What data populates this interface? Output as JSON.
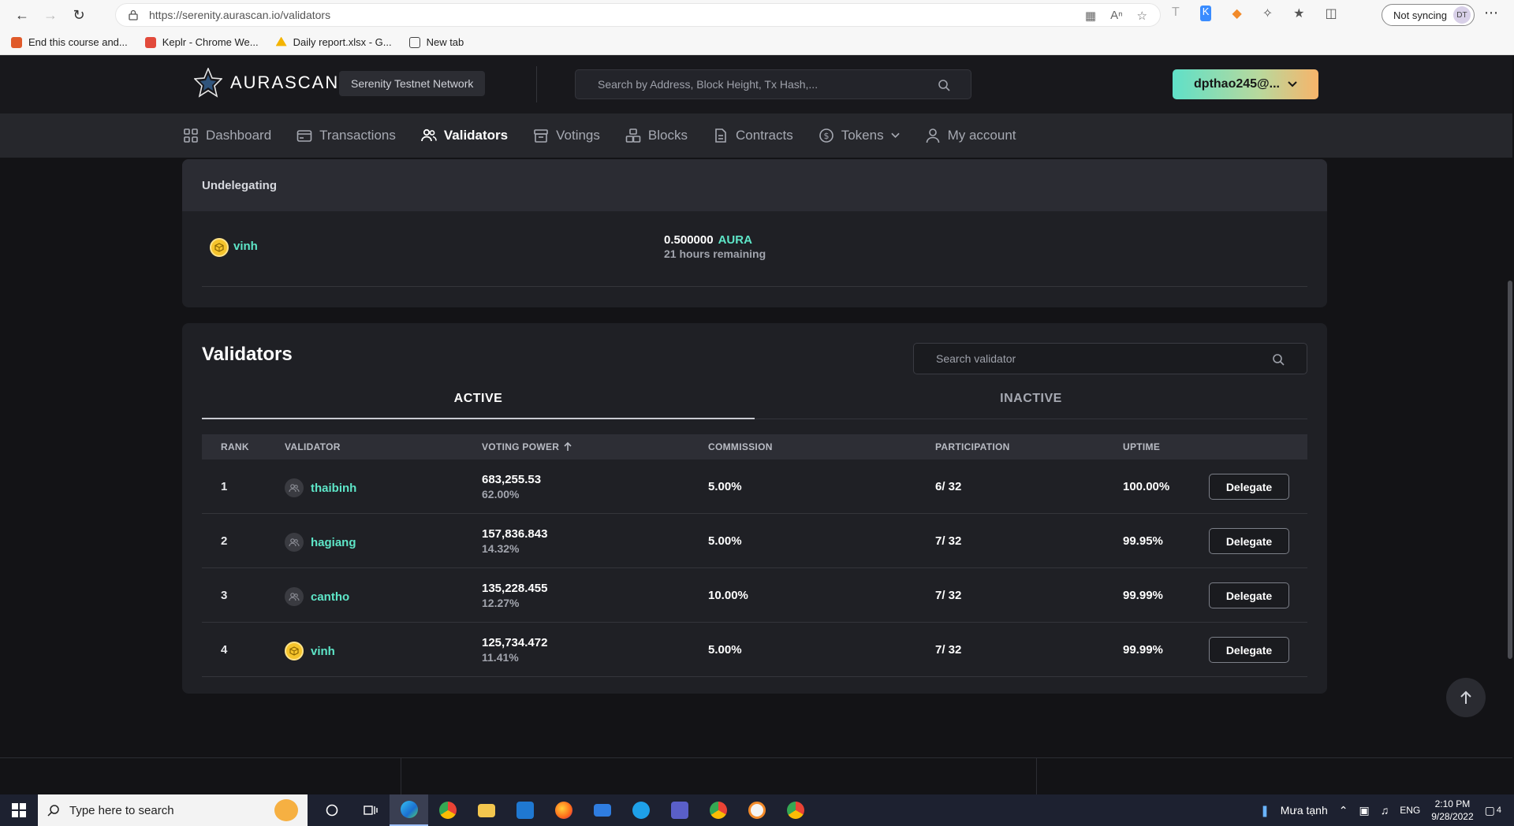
{
  "browser": {
    "url": "https://serenity.aurascan.io/validators",
    "sync_label": "Not syncing",
    "profile_initials": "DT",
    "bookmarks": [
      {
        "label": "End this course and...",
        "color": "#e05a2a"
      },
      {
        "label": "Keplr - Chrome We...",
        "color": "#e24a3b"
      },
      {
        "label": "Daily report.xlsx - G...",
        "color": "#f4b400"
      },
      {
        "label": "New tab",
        "color": "#444444"
      }
    ]
  },
  "header": {
    "logo_text": "AURASCAN",
    "network": "Serenity Testnet Network",
    "search_placeholder": "Search by Address, Block Height, Tx Hash,...",
    "wallet_label": "dpthao245@..."
  },
  "nav": [
    {
      "label": "Dashboard",
      "icon": "dashboard-icon",
      "active": false
    },
    {
      "label": "Transactions",
      "icon": "transactions-icon",
      "active": false
    },
    {
      "label": "Validators",
      "icon": "validators-icon",
      "active": true
    },
    {
      "label": "Votings",
      "icon": "votings-icon",
      "active": false
    },
    {
      "label": "Blocks",
      "icon": "blocks-icon",
      "active": false
    },
    {
      "label": "Contracts",
      "icon": "contracts-icon",
      "active": false
    },
    {
      "label": "Tokens",
      "icon": "tokens-icon",
      "active": false
    },
    {
      "label": "My account",
      "icon": "account-icon",
      "active": false
    }
  ],
  "undelegating": {
    "heading": "Undelegating",
    "row": {
      "name": "vinh",
      "amount": "0.500000",
      "denom": "AURA",
      "remaining": "21 hours remaining"
    }
  },
  "validators": {
    "title": "Validators",
    "search_placeholder": "Search validator",
    "tabs": [
      "ACTIVE",
      "INACTIVE"
    ],
    "columns": {
      "rank": "RANK",
      "validator": "VALIDATOR",
      "voting_power": "VOTING POWER",
      "commission": "COMMISSION",
      "participation": "PARTICIPATION",
      "uptime": "UPTIME"
    },
    "delegate_label": "Delegate",
    "rows": [
      {
        "rank": "1",
        "name": "thaibinh",
        "avatar": "gray",
        "power": "683,255.53",
        "percent": "62.00%",
        "commission": "5.00%",
        "participation": "6/ 32",
        "uptime": "100.00%"
      },
      {
        "rank": "2",
        "name": "hagiang",
        "avatar": "gray",
        "power": "157,836.843",
        "percent": "14.32%",
        "commission": "5.00%",
        "participation": "7/ 32",
        "uptime": "99.95%"
      },
      {
        "rank": "3",
        "name": "cantho",
        "avatar": "gray",
        "power": "135,228.455",
        "percent": "12.27%",
        "commission": "10.00%",
        "participation": "7/ 32",
        "uptime": "99.99%"
      },
      {
        "rank": "4",
        "name": "vinh",
        "avatar": "gold",
        "power": "125,734.472",
        "percent": "11.41%",
        "commission": "5.00%",
        "participation": "7/ 32",
        "uptime": "99.99%"
      }
    ]
  },
  "taskbar": {
    "search_placeholder": "Type here to search",
    "weather": "Mưa tạnh",
    "lang": "ENG",
    "time": "2:10 PM",
    "date": "9/28/2022",
    "notif_count": "4"
  },
  "colors": {
    "accent": "#5ee6c8",
    "background": "#131316",
    "card": "#1f2025"
  }
}
